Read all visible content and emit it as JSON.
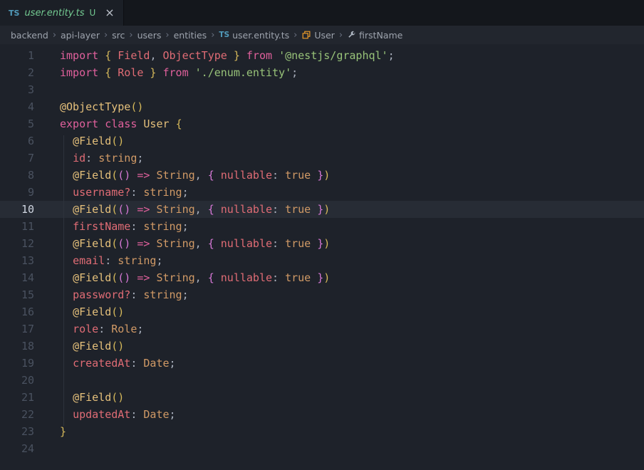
{
  "colors": {
    "bg-tabbar": "#14171c",
    "bg-tab-active": "#1b1f26",
    "bg-breadcrumbs": "#22262e",
    "bg-editor": "#1e222a",
    "bg-active-line": "#272c35",
    "line-number": "#4a5260",
    "line-number-active": "#ced4df",
    "indent-guide": "#2d323c",
    "kw": "#e0609c",
    "red": "#e06c75",
    "deco": "#e5c07b",
    "cls": "#e5c07b",
    "type": "#d19a66",
    "str": "#98c379",
    "pun": "#abb2bf",
    "txt": "#abb2bf",
    "b1": "#d5b85a",
    "b2": "#d678d6",
    "tab-file": "#73c991",
    "git-untracked": "#73c991",
    "ts-icon": "#519aba",
    "class-icon": "#ee9d28",
    "field-icon": "#b0b8c4",
    "breadcrumb-text": "#9da3ad"
  },
  "tab": {
    "file_type": "TS",
    "filename": "user.entity.ts",
    "git_status": "U",
    "close": "×"
  },
  "breadcrumbs": [
    {
      "label": "backend"
    },
    {
      "label": "api-layer"
    },
    {
      "label": "src"
    },
    {
      "label": "users"
    },
    {
      "label": "entities"
    },
    {
      "label": "user.entity.ts",
      "icon": "ts"
    },
    {
      "label": "User",
      "icon": "class"
    },
    {
      "label": "firstName",
      "icon": "field"
    }
  ],
  "editor": {
    "active_line": 10,
    "lines": [
      {
        "num": 1,
        "tokens": [
          [
            "import",
            "kw"
          ],
          [
            " { ",
            "b1"
          ],
          [
            "Field",
            "red"
          ],
          [
            ", ",
            "pun"
          ],
          [
            "ObjectType",
            "red"
          ],
          [
            " }",
            "b1"
          ],
          [
            " ",
            "pun"
          ],
          [
            "from",
            "kw"
          ],
          [
            " ",
            "pun"
          ],
          [
            "'@nestjs/graphql'",
            "str"
          ],
          [
            ";",
            "pun"
          ]
        ]
      },
      {
        "num": 2,
        "tokens": [
          [
            "import",
            "kw"
          ],
          [
            " { ",
            "b1"
          ],
          [
            "Role",
            "red"
          ],
          [
            " }",
            "b1"
          ],
          [
            " ",
            "pun"
          ],
          [
            "from",
            "kw"
          ],
          [
            " ",
            "pun"
          ],
          [
            "'./enum.entity'",
            "str"
          ],
          [
            ";",
            "pun"
          ]
        ]
      },
      {
        "num": 3,
        "tokens": []
      },
      {
        "num": 4,
        "tokens": [
          [
            "@ObjectType",
            "deco"
          ],
          [
            "()",
            "b1"
          ]
        ]
      },
      {
        "num": 5,
        "tokens": [
          [
            "export",
            "kw"
          ],
          [
            " ",
            "pun"
          ],
          [
            "class",
            "kw"
          ],
          [
            " ",
            "pun"
          ],
          [
            "User",
            "cls"
          ],
          [
            " ",
            "pun"
          ],
          [
            "{",
            "b1"
          ]
        ]
      },
      {
        "num": 6,
        "tokens": [
          [
            "  ",
            "txt"
          ],
          [
            "@Field",
            "deco"
          ],
          [
            "()",
            "b1"
          ]
        ]
      },
      {
        "num": 7,
        "tokens": [
          [
            "  ",
            "txt"
          ],
          [
            "id",
            "red"
          ],
          [
            ": ",
            "pun"
          ],
          [
            "string",
            "type"
          ],
          [
            ";",
            "pun"
          ]
        ]
      },
      {
        "num": 8,
        "tokens": [
          [
            "  ",
            "txt"
          ],
          [
            "@Field",
            "deco"
          ],
          [
            "(",
            "b1"
          ],
          [
            "()",
            "b2"
          ],
          [
            " ",
            "pun"
          ],
          [
            "=>",
            "kw"
          ],
          [
            " ",
            "pun"
          ],
          [
            "String",
            "type"
          ],
          [
            ", ",
            "pun"
          ],
          [
            "{ ",
            "b2"
          ],
          [
            "nullable",
            "red"
          ],
          [
            ": ",
            "pun"
          ],
          [
            "true",
            "type"
          ],
          [
            " ",
            "pun"
          ],
          [
            "}",
            "b2"
          ],
          [
            ")",
            "b1"
          ]
        ]
      },
      {
        "num": 9,
        "tokens": [
          [
            "  ",
            "txt"
          ],
          [
            "username?",
            "red"
          ],
          [
            ": ",
            "pun"
          ],
          [
            "string",
            "type"
          ],
          [
            ";",
            "pun"
          ]
        ]
      },
      {
        "num": 10,
        "tokens": [
          [
            "  ",
            "txt"
          ],
          [
            "@Field",
            "deco"
          ],
          [
            "(",
            "b1"
          ],
          [
            "()",
            "b2"
          ],
          [
            " ",
            "pun"
          ],
          [
            "=>",
            "kw"
          ],
          [
            " ",
            "pun"
          ],
          [
            "String",
            "type"
          ],
          [
            ", ",
            "pun"
          ],
          [
            "{ ",
            "b2"
          ],
          [
            "nullable",
            "red"
          ],
          [
            ": ",
            "pun"
          ],
          [
            "true",
            "type"
          ],
          [
            " ",
            "pun"
          ],
          [
            "}",
            "b2"
          ],
          [
            ")",
            "b1"
          ]
        ]
      },
      {
        "num": 11,
        "tokens": [
          [
            "  ",
            "txt"
          ],
          [
            "firstName",
            "red"
          ],
          [
            ": ",
            "pun"
          ],
          [
            "string",
            "type"
          ],
          [
            ";",
            "pun"
          ]
        ]
      },
      {
        "num": 12,
        "tokens": [
          [
            "  ",
            "txt"
          ],
          [
            "@Field",
            "deco"
          ],
          [
            "(",
            "b1"
          ],
          [
            "()",
            "b2"
          ],
          [
            " ",
            "pun"
          ],
          [
            "=>",
            "kw"
          ],
          [
            " ",
            "pun"
          ],
          [
            "String",
            "type"
          ],
          [
            ", ",
            "pun"
          ],
          [
            "{ ",
            "b2"
          ],
          [
            "nullable",
            "red"
          ],
          [
            ": ",
            "pun"
          ],
          [
            "true",
            "type"
          ],
          [
            " ",
            "pun"
          ],
          [
            "}",
            "b2"
          ],
          [
            ")",
            "b1"
          ]
        ]
      },
      {
        "num": 13,
        "tokens": [
          [
            "  ",
            "txt"
          ],
          [
            "email",
            "red"
          ],
          [
            ": ",
            "pun"
          ],
          [
            "string",
            "type"
          ],
          [
            ";",
            "pun"
          ]
        ]
      },
      {
        "num": 14,
        "tokens": [
          [
            "  ",
            "txt"
          ],
          [
            "@Field",
            "deco"
          ],
          [
            "(",
            "b1"
          ],
          [
            "()",
            "b2"
          ],
          [
            " ",
            "pun"
          ],
          [
            "=>",
            "kw"
          ],
          [
            " ",
            "pun"
          ],
          [
            "String",
            "type"
          ],
          [
            ", ",
            "pun"
          ],
          [
            "{ ",
            "b2"
          ],
          [
            "nullable",
            "red"
          ],
          [
            ": ",
            "pun"
          ],
          [
            "true",
            "type"
          ],
          [
            " ",
            "pun"
          ],
          [
            "}",
            "b2"
          ],
          [
            ")",
            "b1"
          ]
        ]
      },
      {
        "num": 15,
        "tokens": [
          [
            "  ",
            "txt"
          ],
          [
            "password?",
            "red"
          ],
          [
            ": ",
            "pun"
          ],
          [
            "string",
            "type"
          ],
          [
            ";",
            "pun"
          ]
        ]
      },
      {
        "num": 16,
        "tokens": [
          [
            "  ",
            "txt"
          ],
          [
            "@Field",
            "deco"
          ],
          [
            "()",
            "b1"
          ]
        ]
      },
      {
        "num": 17,
        "tokens": [
          [
            "  ",
            "txt"
          ],
          [
            "role",
            "red"
          ],
          [
            ": ",
            "pun"
          ],
          [
            "Role",
            "type"
          ],
          [
            ";",
            "pun"
          ]
        ]
      },
      {
        "num": 18,
        "tokens": [
          [
            "  ",
            "txt"
          ],
          [
            "@Field",
            "deco"
          ],
          [
            "()",
            "b1"
          ]
        ]
      },
      {
        "num": 19,
        "tokens": [
          [
            "  ",
            "txt"
          ],
          [
            "createdAt",
            "red"
          ],
          [
            ": ",
            "pun"
          ],
          [
            "Date",
            "type"
          ],
          [
            ";",
            "pun"
          ]
        ]
      },
      {
        "num": 20,
        "tokens": []
      },
      {
        "num": 21,
        "tokens": [
          [
            "  ",
            "txt"
          ],
          [
            "@Field",
            "deco"
          ],
          [
            "()",
            "b1"
          ]
        ]
      },
      {
        "num": 22,
        "tokens": [
          [
            "  ",
            "txt"
          ],
          [
            "updatedAt",
            "red"
          ],
          [
            ": ",
            "pun"
          ],
          [
            "Date",
            "type"
          ],
          [
            ";",
            "pun"
          ]
        ]
      },
      {
        "num": 23,
        "tokens": [
          [
            "}",
            "b1"
          ]
        ]
      },
      {
        "num": 24,
        "tokens": []
      }
    ]
  }
}
